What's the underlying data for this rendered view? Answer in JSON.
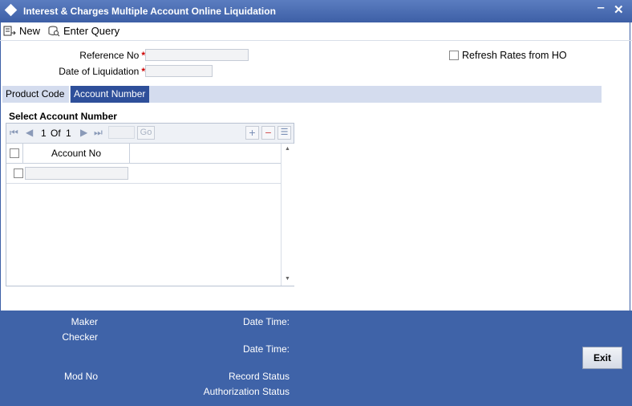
{
  "window": {
    "title": "Interest & Charges Multiple Account Online Liquidation",
    "minimize_icon": "minimize-icon",
    "close_icon": "close-icon"
  },
  "toolbar": {
    "new_label": "New",
    "enter_query_label": "Enter Query"
  },
  "form": {
    "reference_no_label": "Reference No",
    "date_of_liquidation_label": "Date of Liquidation",
    "required_marker": "*",
    "reference_no_value": "",
    "date_of_liquidation_value": "",
    "refresh_rates_label": "Refresh Rates from HO",
    "refresh_rates_checked": false
  },
  "tabs": [
    {
      "label": "Product Code",
      "active": false
    },
    {
      "label": "Account Number",
      "active": true
    }
  ],
  "section": {
    "title": "Select Account Number"
  },
  "grid": {
    "pager_current": "1",
    "pager_of": "Of",
    "pager_total": "1",
    "go_label": "Go",
    "columns": [
      "Account No"
    ],
    "rows": [
      {
        "account_no": ""
      }
    ]
  },
  "footer": {
    "maker_label": "Maker",
    "checker_label": "Checker",
    "date_time_label_1": "Date Time:",
    "date_time_label_2": "Date Time:",
    "mod_no_label": "Mod No",
    "record_status_label": "Record Status",
    "authorization_status_label": "Authorization Status",
    "exit_label": "Exit"
  },
  "colors": {
    "title_bar": "#3d5fa6",
    "active_tab": "#2e4f9a",
    "tab_strip": "#d4dcee",
    "footer": "#3f63a8",
    "required": "#cc0000"
  }
}
